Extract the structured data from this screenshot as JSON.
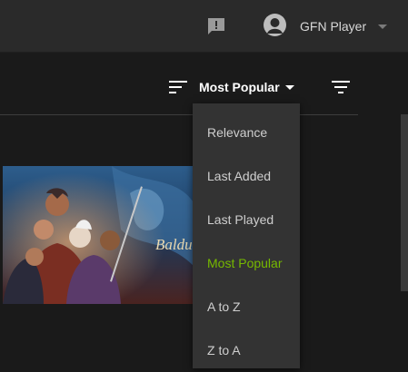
{
  "header": {
    "username": "GFN Player",
    "icons": [
      "feedback-icon",
      "user-avatar-icon",
      "chevron-down-icon"
    ]
  },
  "sort": {
    "current_label": "Most Popular",
    "options": [
      {
        "label": "Relevance",
        "selected": false
      },
      {
        "label": "Last Added",
        "selected": false
      },
      {
        "label": "Last Played",
        "selected": false
      },
      {
        "label": "Most Popular",
        "selected": true
      },
      {
        "label": "A to Z",
        "selected": false
      },
      {
        "label": "Z to A",
        "selected": false
      }
    ]
  },
  "game_card": {
    "logo_text": "Baldur's Gate"
  },
  "colors": {
    "accent": "#76b900",
    "background": "#1a1a1a",
    "topbar": "#2a2a2a",
    "menu": "#333333"
  }
}
